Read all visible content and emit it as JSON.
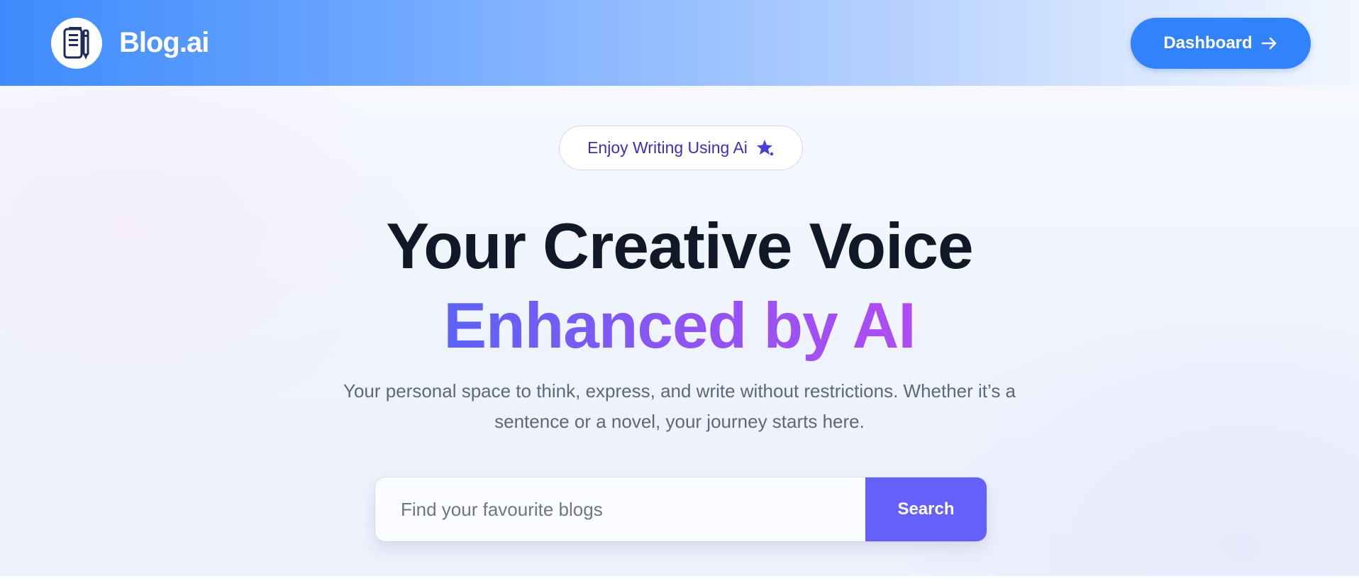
{
  "header": {
    "brand": "Blog.ai",
    "logo_icon": "notebook-pen-icon",
    "dashboard_label": "Dashboard",
    "dashboard_icon": "arrow-right-icon"
  },
  "hero": {
    "pill_label": "Enjoy Writing Using Ai",
    "pill_icon": "sparkle-star-icon",
    "title_line1": "Your Creative Voice",
    "title_line2": "Enhanced by AI",
    "subtitle_line1": "Your personal space to think, express, and write without restrictions. Whether it’s a",
    "subtitle_line2": "sentence or a novel, your journey starts here."
  },
  "search": {
    "placeholder": "Find your favourite blogs",
    "value": "",
    "button_label": "Search"
  },
  "colors": {
    "accent_blue": "#3283fb",
    "search_button": "#6660fb",
    "title_dark": "#111827",
    "gradient_start": "#5b63f6",
    "gradient_end": "#b04cf2",
    "pill_text": "#3e2fb8"
  }
}
